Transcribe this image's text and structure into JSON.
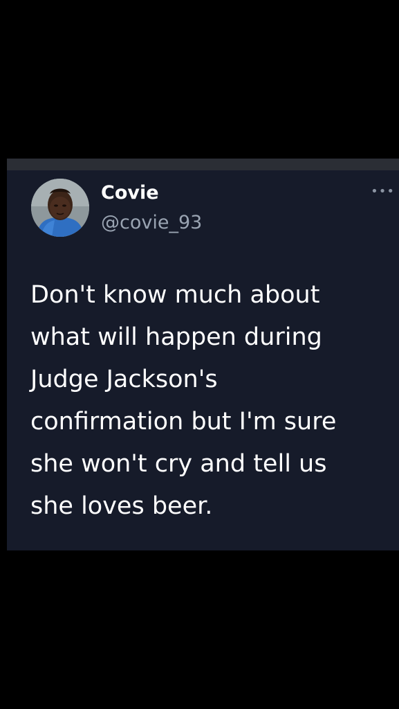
{
  "tweet": {
    "author": {
      "display_name": "Covie",
      "handle": "@covie_93",
      "avatar": "profile-photo"
    },
    "more_icon": "ellipsis-icon",
    "text_lines": [
      "Don't know much about",
      "what will happen during",
      "Judge Jackson's",
      "confirmation but I'm sure",
      "she won't cry and tell us",
      "she loves beer."
    ]
  },
  "colors": {
    "background": "#000000",
    "card": "#161b2a",
    "text": "#ffffff",
    "handle": "#9aa4b2"
  }
}
